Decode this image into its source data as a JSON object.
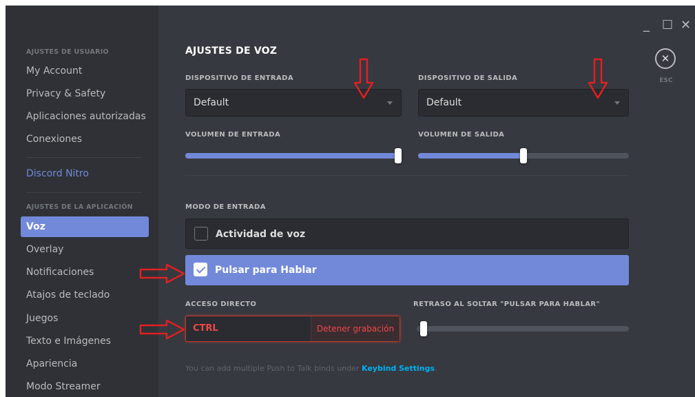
{
  "window": {
    "minimize": "_",
    "maximize": "☐",
    "close": "✕"
  },
  "close_button": {
    "glyph": "✕",
    "label": "ESC"
  },
  "sidebar": {
    "user_settings_header": "AJUSTES DE USUARIO",
    "user_items": [
      "My Account",
      "Privacy & Safety",
      "Aplicaciones autorizadas",
      "Conexiones"
    ],
    "nitro": "Discord Nitro",
    "app_settings_header": "AJUSTES DE LA APLICACIÓN",
    "app_items": [
      "Voz",
      "Overlay",
      "Notificaciones",
      "Atajos de teclado",
      "Juegos",
      "Texto e Imágenes",
      "Apariencia",
      "Modo Streamer"
    ],
    "active_item": "Voz"
  },
  "main": {
    "title": "AJUSTES DE VOZ",
    "input_device": {
      "label": "DISPOSITIVO DE ENTRADA",
      "value": "Default"
    },
    "output_device": {
      "label": "DISPOSITIVO DE SALIDA",
      "value": "Default"
    },
    "input_volume": {
      "label": "VOLUMEN DE ENTRADA",
      "level": 1.0
    },
    "output_volume": {
      "label": "VOLUMEN DE SALIDA",
      "level": 0.5
    },
    "input_mode": {
      "label": "MODO DE ENTRADA",
      "options": [
        {
          "label": "Actividad de voz",
          "selected": false
        },
        {
          "label": "Pulsar para Hablar",
          "selected": true
        }
      ]
    },
    "shortcut": {
      "label": "ACCESO DIRECTO",
      "key": "CTRL",
      "stop_label": "Detener grabación"
    },
    "release_delay": {
      "label": "RETRASO AL SOLTAR \"PULSAR PARA HABLAR\"",
      "level": 0.0
    },
    "hint": {
      "text": "You can add multiple Push to Talk binds under ",
      "link": "Keybind Settings",
      "suffix": "."
    }
  },
  "colors": {
    "accent": "#7289da",
    "annotation_arrow": "#e02020",
    "recording": "#f04747",
    "link": "#00b0f4"
  }
}
